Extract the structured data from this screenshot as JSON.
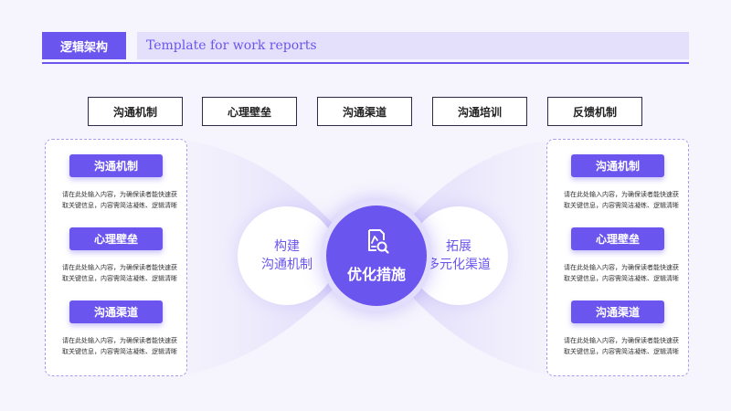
{
  "header": {
    "tag": "逻辑架构",
    "subtitle": "Template for work reports"
  },
  "top_boxes": [
    "沟通机制",
    "心理壁垒",
    "沟通渠道",
    "沟通培训",
    "反馈机制"
  ],
  "left_panel": {
    "items": [
      {
        "label": "沟通机制",
        "desc1": "请在此处输入内容，为确保读者能快速获",
        "desc2": "取关键信息，内容需简洁凝练、逻辑清晰"
      },
      {
        "label": "心理壁垒",
        "desc1": "请在此处输入内容，为确保读者能快速获",
        "desc2": "取关键信息，内容需简洁凝练、逻辑清晰"
      },
      {
        "label": "沟通渠道",
        "desc1": "请在此处输入内容，为确保读者能快速获",
        "desc2": "取关键信息，内容需简洁凝练、逻辑清晰"
      }
    ]
  },
  "right_panel": {
    "items": [
      {
        "label": "沟通机制",
        "desc1": "请在此处输入内容，为确保读者能快速获",
        "desc2": "取关键信息，内容需简洁凝练、逻辑清晰"
      },
      {
        "label": "心理壁垒",
        "desc1": "请在此处输入内容，为确保读者能快速获",
        "desc2": "取关键信息，内容需简洁凝练、逻辑清晰"
      },
      {
        "label": "沟通渠道",
        "desc1": "请在此处输入内容，为确保读者能快速获",
        "desc2": "取关键信息，内容需简洁凝练、逻辑清晰"
      }
    ]
  },
  "center": {
    "left_line1": "构建",
    "left_line2": "沟通机制",
    "main": "优化措施",
    "main_icon": "document-search-icon",
    "right_line1": "拓展",
    "right_line2": "多元化渠道"
  },
  "colors": {
    "accent": "#6a55ee",
    "accent_light": "#e4e0fb",
    "background": "#f6f5fd"
  }
}
